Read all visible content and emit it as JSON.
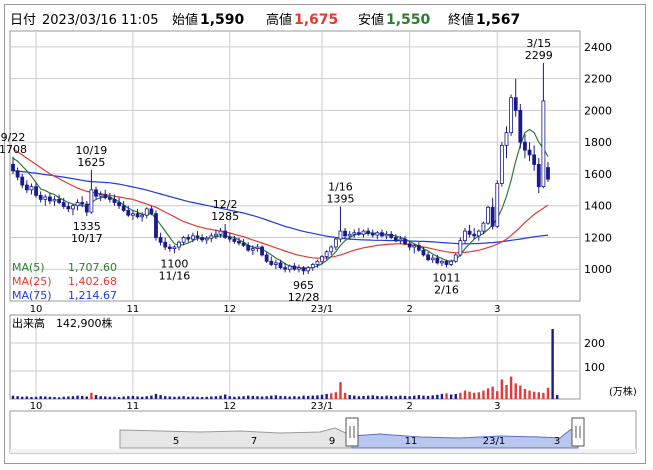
{
  "header": {
    "date_label": "日付",
    "date_value": "2023/03/16 11:05",
    "open_label": "始値",
    "open_value": "1,590",
    "high_label": "高値",
    "high_value": "1,675",
    "low_label": "安値",
    "low_value": "1,550",
    "close_label": "終値",
    "close_value": "1,567"
  },
  "colors": {
    "up": "#1a1a8c",
    "down": "#1a1a8c",
    "ma5": "#2e7d32",
    "ma25": "#e53935",
    "ma75": "#1e3adf",
    "volume": "#1a1a8c",
    "volume_high": "#e53935",
    "grid": "#cccccc",
    "high_text": "#e53935",
    "low_text": "#2e7d32"
  },
  "legend": [
    {
      "label": "MA(5)",
      "value": "1,707.60",
      "color": "#2e7d32"
    },
    {
      "label": "MA(25)",
      "value": "1,402.68",
      "color": "#e53935"
    },
    {
      "label": "MA(75)",
      "value": "1,214.67",
      "color": "#1e3adf"
    }
  ],
  "volume_panel": {
    "label": "出来高",
    "value": "142,900株",
    "unit": "(万株)",
    "y_ticks": [
      "100",
      "200"
    ]
  },
  "chart_data": {
    "type": "candlestick",
    "y_ticks": [
      "1000",
      "1200",
      "1400",
      "1600",
      "1800",
      "2000",
      "2200",
      "2400"
    ],
    "ylim": [
      800,
      2500
    ],
    "x_ticks": [
      {
        "label": "10",
        "i": 5
      },
      {
        "label": "11",
        "i": 26
      },
      {
        "label": "12",
        "i": 47
      },
      {
        "label": "23/1",
        "i": 67
      },
      {
        "label": "2",
        "i": 86
      },
      {
        "label": "3",
        "i": 105
      }
    ],
    "annotations": [
      {
        "i": 0,
        "lines": [
          "9/22",
          "1708"
        ],
        "pos": "above",
        "price": 1708
      },
      {
        "i": 17,
        "lines": [
          "10/19",
          "1625"
        ],
        "pos": "above",
        "price": 1625
      },
      {
        "i": 16,
        "lines": [
          "1335",
          "10/17"
        ],
        "pos": "below",
        "price": 1335
      },
      {
        "i": 35,
        "lines": [
          "1100",
          "11/16"
        ],
        "pos": "below",
        "price": 1100
      },
      {
        "i": 46,
        "lines": [
          "12/2",
          "1285"
        ],
        "pos": "above",
        "price": 1285
      },
      {
        "i": 63,
        "lines": [
          "965",
          "12/28"
        ],
        "pos": "below",
        "price": 965
      },
      {
        "i": 71,
        "lines": [
          "1/16",
          "1395"
        ],
        "pos": "above",
        "price": 1395
      },
      {
        "i": 94,
        "lines": [
          "1011",
          "2/16"
        ],
        "pos": "below",
        "price": 1011
      },
      {
        "i": 114,
        "lines": [
          "3/15",
          "2299"
        ],
        "pos": "above",
        "price": 2299
      }
    ],
    "candles": [
      [
        1660,
        1708,
        1600,
        1620
      ],
      [
        1620,
        1640,
        1560,
        1580
      ],
      [
        1580,
        1600,
        1510,
        1530
      ],
      [
        1530,
        1560,
        1480,
        1500
      ],
      [
        1500,
        1540,
        1470,
        1520
      ],
      [
        1520,
        1545,
        1450,
        1465
      ],
      [
        1465,
        1490,
        1420,
        1440
      ],
      [
        1440,
        1470,
        1400,
        1455
      ],
      [
        1455,
        1480,
        1410,
        1430
      ],
      [
        1430,
        1460,
        1400,
        1440
      ],
      [
        1440,
        1470,
        1410,
        1420
      ],
      [
        1420,
        1450,
        1380,
        1395
      ],
      [
        1395,
        1420,
        1360,
        1380
      ],
      [
        1380,
        1410,
        1340,
        1400
      ],
      [
        1400,
        1440,
        1370,
        1420
      ],
      [
        1420,
        1460,
        1390,
        1410
      ],
      [
        1410,
        1430,
        1335,
        1360
      ],
      [
        1360,
        1625,
        1350,
        1500
      ],
      [
        1500,
        1520,
        1440,
        1460
      ],
      [
        1460,
        1490,
        1430,
        1470
      ],
      [
        1470,
        1500,
        1440,
        1450
      ],
      [
        1450,
        1480,
        1420,
        1440
      ],
      [
        1440,
        1470,
        1400,
        1420
      ],
      [
        1420,
        1450,
        1380,
        1400
      ],
      [
        1400,
        1430,
        1360,
        1370
      ],
      [
        1370,
        1400,
        1330,
        1340
      ],
      [
        1340,
        1370,
        1310,
        1350
      ],
      [
        1350,
        1380,
        1320,
        1330
      ],
      [
        1330,
        1360,
        1300,
        1340
      ],
      [
        1340,
        1390,
        1320,
        1380
      ],
      [
        1380,
        1400,
        1340,
        1350
      ],
      [
        1350,
        1370,
        1180,
        1200
      ],
      [
        1200,
        1230,
        1150,
        1170
      ],
      [
        1170,
        1200,
        1120,
        1140
      ],
      [
        1140,
        1160,
        1110,
        1130
      ],
      [
        1130,
        1150,
        1100,
        1140
      ],
      [
        1140,
        1180,
        1120,
        1170
      ],
      [
        1170,
        1210,
        1150,
        1200
      ],
      [
        1200,
        1220,
        1170,
        1190
      ],
      [
        1190,
        1230,
        1170,
        1210
      ],
      [
        1210,
        1240,
        1180,
        1200
      ],
      [
        1200,
        1220,
        1170,
        1185
      ],
      [
        1185,
        1210,
        1160,
        1195
      ],
      [
        1195,
        1230,
        1170,
        1210
      ],
      [
        1210,
        1250,
        1190,
        1220
      ],
      [
        1220,
        1260,
        1200,
        1240
      ],
      [
        1240,
        1285,
        1190,
        1200
      ],
      [
        1200,
        1230,
        1170,
        1190
      ],
      [
        1190,
        1210,
        1160,
        1175
      ],
      [
        1175,
        1200,
        1150,
        1165
      ],
      [
        1165,
        1190,
        1140,
        1150
      ],
      [
        1150,
        1170,
        1110,
        1120
      ],
      [
        1120,
        1150,
        1090,
        1130
      ],
      [
        1130,
        1160,
        1110,
        1140
      ],
      [
        1140,
        1150,
        1080,
        1090
      ],
      [
        1090,
        1110,
        1040,
        1050
      ],
      [
        1050,
        1080,
        1020,
        1030
      ],
      [
        1030,
        1060,
        1000,
        1040
      ],
      [
        1040,
        1060,
        1000,
        1010
      ],
      [
        1010,
        1040,
        980,
        1000
      ],
      [
        1000,
        1030,
        980,
        1020
      ],
      [
        1020,
        1040,
        990,
        1000
      ],
      [
        1000,
        1030,
        980,
        1010
      ],
      [
        1010,
        1020,
        965,
        990
      ],
      [
        990,
        1020,
        970,
        1010
      ],
      [
        1010,
        1040,
        990,
        1030
      ],
      [
        1030,
        1060,
        1010,
        1050
      ],
      [
        1050,
        1090,
        1030,
        1080
      ],
      [
        1080,
        1120,
        1060,
        1110
      ],
      [
        1110,
        1150,
        1090,
        1140
      ],
      [
        1140,
        1200,
        1120,
        1190
      ],
      [
        1190,
        1395,
        1170,
        1240
      ],
      [
        1240,
        1260,
        1190,
        1210
      ],
      [
        1210,
        1240,
        1190,
        1220
      ],
      [
        1220,
        1250,
        1200,
        1230
      ],
      [
        1230,
        1260,
        1210,
        1220
      ],
      [
        1220,
        1250,
        1200,
        1240
      ],
      [
        1240,
        1260,
        1210,
        1225
      ],
      [
        1225,
        1250,
        1200,
        1215
      ],
      [
        1215,
        1240,
        1190,
        1230
      ],
      [
        1230,
        1250,
        1200,
        1210
      ],
      [
        1210,
        1240,
        1190,
        1220
      ],
      [
        1220,
        1240,
        1190,
        1200
      ],
      [
        1200,
        1220,
        1170,
        1180
      ],
      [
        1180,
        1210,
        1160,
        1190
      ],
      [
        1190,
        1210,
        1150,
        1160
      ],
      [
        1160,
        1180,
        1120,
        1140
      ],
      [
        1140,
        1160,
        1100,
        1150
      ],
      [
        1150,
        1170,
        1110,
        1120
      ],
      [
        1120,
        1140,
        1080,
        1090
      ],
      [
        1090,
        1110,
        1050,
        1060
      ],
      [
        1060,
        1090,
        1040,
        1070
      ],
      [
        1070,
        1090,
        1030,
        1040
      ],
      [
        1040,
        1060,
        1020,
        1050
      ],
      [
        1050,
        1060,
        1011,
        1030
      ],
      [
        1030,
        1060,
        1020,
        1050
      ],
      [
        1050,
        1100,
        1040,
        1090
      ],
      [
        1090,
        1200,
        1080,
        1180
      ],
      [
        1180,
        1260,
        1160,
        1240
      ],
      [
        1240,
        1280,
        1200,
        1220
      ],
      [
        1220,
        1260,
        1190,
        1210
      ],
      [
        1210,
        1250,
        1180,
        1240
      ],
      [
        1240,
        1300,
        1220,
        1290
      ],
      [
        1290,
        1400,
        1280,
        1390
      ],
      [
        1390,
        1450,
        1250,
        1270
      ],
      [
        1270,
        1560,
        1260,
        1540
      ],
      [
        1540,
        1800,
        1520,
        1780
      ],
      [
        1780,
        1900,
        1700,
        1860
      ],
      [
        1860,
        2100,
        1840,
        2080
      ],
      [
        2080,
        2200,
        1960,
        2000
      ],
      [
        2000,
        2040,
        1760,
        1800
      ],
      [
        1800,
        1850,
        1700,
        1750
      ],
      [
        1750,
        1800,
        1680,
        1720
      ],
      [
        1720,
        1780,
        1620,
        1660
      ],
      [
        1660,
        1700,
        1480,
        1520
      ],
      [
        1520,
        2299,
        1510,
        2060
      ],
      [
        1640,
        1675,
        1550,
        1567
      ]
    ],
    "ma5": [
      1700,
      1680,
      1650,
      1620,
      1585,
      1545,
      1505,
      1495,
      1480,
      1470,
      1450,
      1435,
      1420,
      1410,
      1405,
      1400,
      1395,
      1420,
      1440,
      1450,
      1460,
      1455,
      1440,
      1425,
      1405,
      1385,
      1370,
      1360,
      1345,
      1345,
      1350,
      1320,
      1280,
      1240,
      1200,
      1160,
      1150,
      1155,
      1165,
      1180,
      1195,
      1195,
      1195,
      1200,
      1205,
      1210,
      1210,
      1205,
      1200,
      1185,
      1170,
      1150,
      1140,
      1135,
      1125,
      1110,
      1090,
      1070,
      1055,
      1035,
      1020,
      1015,
      1010,
      1005,
      1005,
      1010,
      1020,
      1035,
      1055,
      1080,
      1110,
      1150,
      1180,
      1200,
      1215,
      1225,
      1225,
      1230,
      1228,
      1225,
      1222,
      1220,
      1215,
      1210,
      1200,
      1190,
      1175,
      1160,
      1145,
      1130,
      1115,
      1095,
      1080,
      1068,
      1055,
      1050,
      1060,
      1090,
      1130,
      1160,
      1190,
      1210,
      1225,
      1250,
      1280,
      1320,
      1380,
      1460,
      1560,
      1680,
      1780,
      1860,
      1880,
      1860,
      1800,
      1760,
      1710
    ],
    "ma25": [
      1760,
      1740,
      1720,
      1700,
      1680,
      1660,
      1640,
      1620,
      1600,
      1585,
      1570,
      1555,
      1540,
      1525,
      1510,
      1500,
      1490,
      1485,
      1480,
      1475,
      1470,
      1465,
      1460,
      1455,
      1450,
      1445,
      1440,
      1430,
      1420,
      1410,
      1400,
      1390,
      1375,
      1360,
      1345,
      1330,
      1315,
      1300,
      1290,
      1280,
      1270,
      1262,
      1255,
      1250,
      1245,
      1240,
      1235,
      1228,
      1220,
      1212,
      1205,
      1195,
      1185,
      1175,
      1165,
      1155,
      1145,
      1135,
      1125,
      1115,
      1105,
      1095,
      1088,
      1082,
      1076,
      1072,
      1070,
      1070,
      1072,
      1076,
      1082,
      1090,
      1100,
      1110,
      1120,
      1128,
      1135,
      1140,
      1145,
      1150,
      1153,
      1156,
      1158,
      1160,
      1160,
      1158,
      1155,
      1150,
      1145,
      1140,
      1135,
      1128,
      1122,
      1116,
      1110,
      1106,
      1104,
      1104,
      1106,
      1110,
      1115,
      1120,
      1128,
      1136,
      1146,
      1158,
      1172,
      1190,
      1212,
      1238,
      1265,
      1295,
      1320,
      1345,
      1365,
      1385,
      1403
    ],
    "ma75": [
      1620,
      1618,
      1615,
      1612,
      1608,
      1605,
      1600,
      1596,
      1592,
      1588,
      1584,
      1580,
      1575,
      1570,
      1565,
      1560,
      1555,
      1552,
      1550,
      1548,
      1546,
      1544,
      1540,
      1536,
      1530,
      1524,
      1518,
      1512,
      1505,
      1498,
      1490,
      1482,
      1474,
      1466,
      1458,
      1450,
      1442,
      1434,
      1426,
      1420,
      1414,
      1408,
      1402,
      1396,
      1390,
      1384,
      1378,
      1372,
      1366,
      1360,
      1354,
      1346,
      1338,
      1330,
      1320,
      1310,
      1300,
      1290,
      1280,
      1270,
      1262,
      1254,
      1246,
      1238,
      1232,
      1226,
      1220,
      1214,
      1208,
      1204,
      1200,
      1196,
      1192,
      1190,
      1188,
      1186,
      1185,
      1184,
      1183,
      1182,
      1182,
      1181,
      1181,
      1180,
      1180,
      1179,
      1178,
      1177,
      1176,
      1175,
      1174,
      1172,
      1170,
      1168,
      1166,
      1164,
      1162,
      1160,
      1160,
      1160,
      1161,
      1162,
      1164,
      1166,
      1168,
      1171,
      1174,
      1178,
      1182,
      1186,
      1190,
      1195,
      1200,
      1204,
      1208,
      1212,
      1215
    ],
    "volume": [
      12,
      10,
      8,
      9,
      7,
      8,
      10,
      9,
      8,
      7,
      6,
      8,
      9,
      10,
      12,
      11,
      9,
      22,
      14,
      10,
      9,
      8,
      8,
      7,
      9,
      10,
      11,
      9,
      8,
      10,
      12,
      18,
      14,
      10,
      9,
      8,
      9,
      10,
      8,
      9,
      8,
      7,
      8,
      9,
      10,
      12,
      16,
      10,
      8,
      9,
      10,
      12,
      11,
      10,
      9,
      10,
      12,
      13,
      11,
      10,
      9,
      10,
      9,
      12,
      11,
      12,
      13,
      15,
      18,
      20,
      24,
      60,
      22,
      14,
      12,
      10,
      11,
      12,
      13,
      11,
      10,
      12,
      11,
      10,
      12,
      11,
      10,
      12,
      14,
      12,
      11,
      13,
      15,
      18,
      20,
      16,
      18,
      22,
      30,
      26,
      22,
      24,
      30,
      38,
      44,
      28,
      70,
      50,
      80,
      56,
      48,
      36,
      30,
      26,
      24,
      22,
      40,
      250,
      14
    ]
  },
  "navigator": {
    "labels": [
      {
        "label": "5",
        "x": 176
      },
      {
        "label": "7",
        "x": 254
      },
      {
        "label": "9",
        "x": 332
      },
      {
        "label": "11",
        "x": 411
      },
      {
        "label": "23/1",
        "x": 494
      },
      {
        "label": "3",
        "x": 557
      }
    ]
  }
}
